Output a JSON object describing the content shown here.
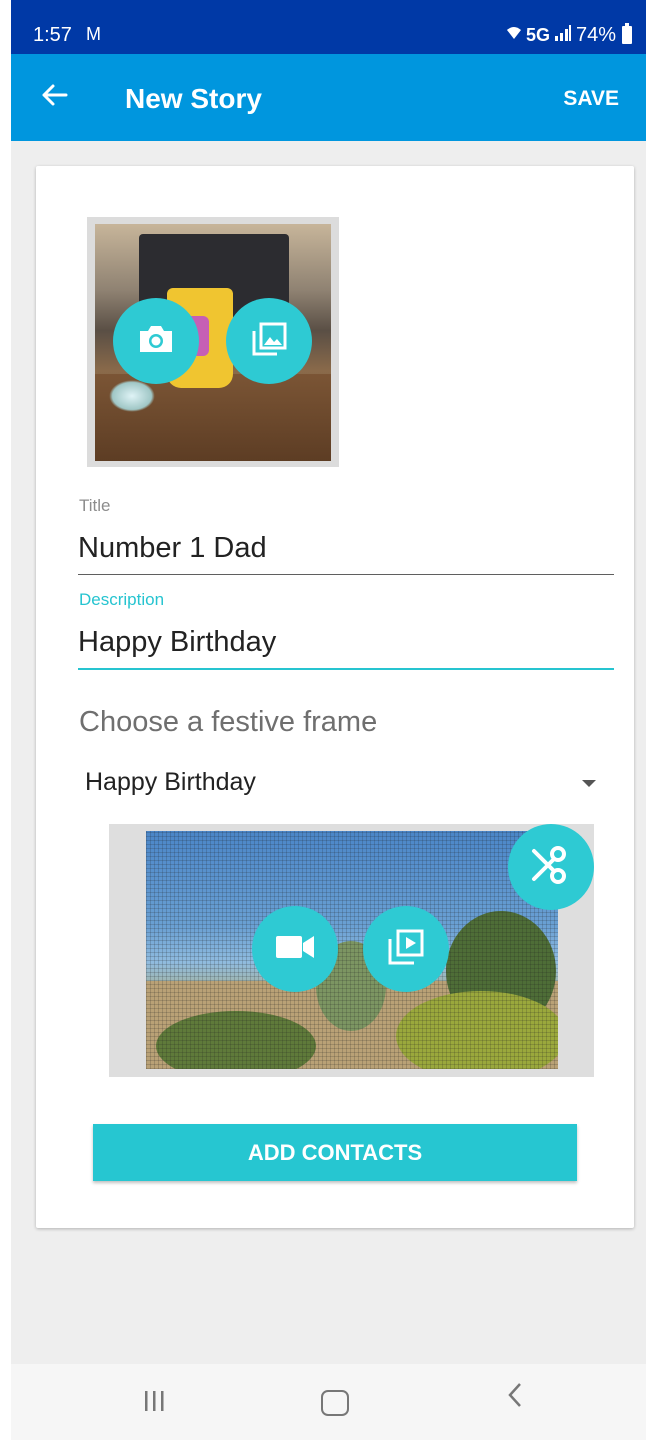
{
  "status_bar": {
    "time": "1:57",
    "mail_icon": "gmail-icon",
    "network": "5G",
    "battery": "74%"
  },
  "app_bar": {
    "title": "New Story",
    "save_label": "SAVE",
    "back_icon": "arrow-left-icon"
  },
  "form": {
    "photo_buttons": [
      "camera-icon",
      "gallery-icon"
    ],
    "title_label": "Title",
    "title_value": "Number 1 Dad",
    "description_label": "Description",
    "description_value": "Happy Birthday",
    "frame_prompt": "Choose a festive frame",
    "frame_selected": "Happy Birthday",
    "video_buttons": [
      "video-camera-icon",
      "video-gallery-icon",
      "scissors-icon"
    ],
    "add_contacts_label": "ADD CONTACTS"
  },
  "colors": {
    "status_bar": "#0039a6",
    "app_bar": "#0096de",
    "accent": "#26c6d1",
    "background": "#eeeeee"
  }
}
